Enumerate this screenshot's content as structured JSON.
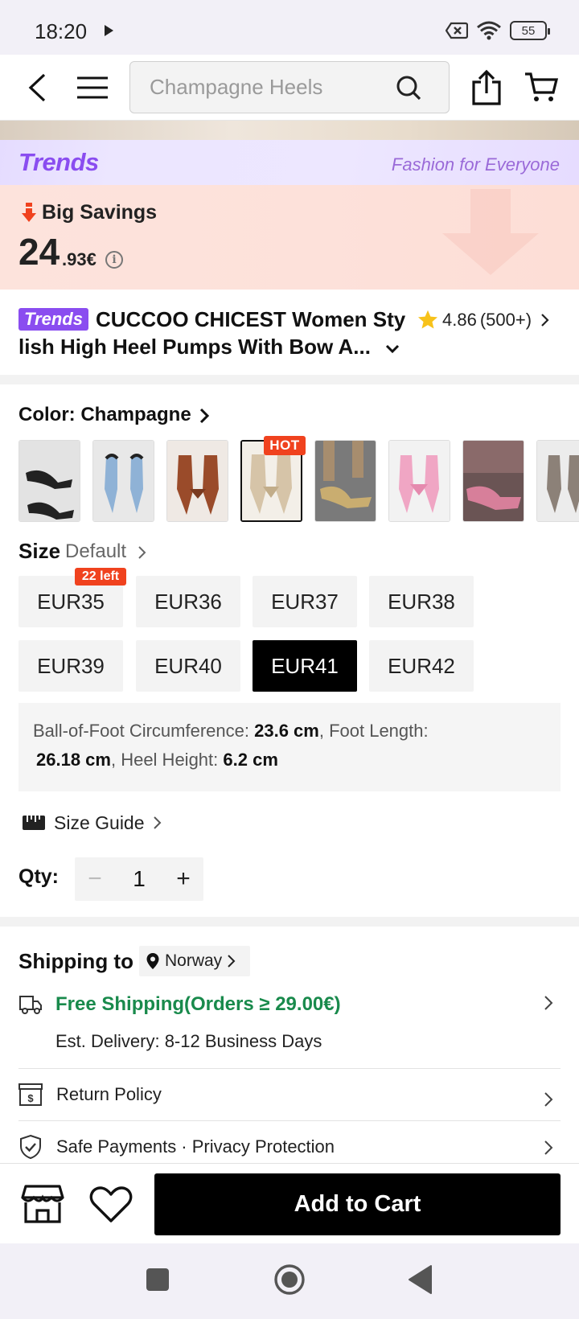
{
  "status_bar": {
    "time": "18:20",
    "battery": "55"
  },
  "header": {
    "search_placeholder": "Champagne Heels"
  },
  "promo": {
    "brand_logo": "Trends",
    "tagline": "Fashion for Everyone",
    "savings_title": "Big Savings",
    "price_whole": "24",
    "price_decimal": ".93€"
  },
  "product": {
    "badge": "Trends",
    "title_line1": "CUCCOO CHICEST Women Sty",
    "title_line2": "lish High Heel Pumps With Bow A...",
    "rating": "4.86",
    "rating_count": "(500+)"
  },
  "color": {
    "label": "Color: Champagne",
    "hot_badge": "HOT",
    "swatches": [
      {
        "name": "Black",
        "colors": [
          "#e3e3e3",
          "#222222"
        ]
      },
      {
        "name": "Blue",
        "colors": [
          "#e8e8e8",
          "#8fb2d6"
        ]
      },
      {
        "name": "Brown",
        "colors": [
          "#efe9e4",
          "#9a4b2a"
        ]
      },
      {
        "name": "Champagne",
        "colors": [
          "#f3efe8",
          "#d6c4a8"
        ]
      },
      {
        "name": "Gold",
        "colors": [
          "#7a7a7a",
          "#c9ad70"
        ]
      },
      {
        "name": "Pink",
        "colors": [
          "#f2f2f2",
          "#f0a6c4"
        ]
      },
      {
        "name": "Rose",
        "colors": [
          "#6a5454",
          "#d77f9a"
        ]
      },
      {
        "name": "Silver",
        "colors": [
          "#ececec",
          "#8c8178"
        ]
      }
    ]
  },
  "size": {
    "label": "Size",
    "default_label": "Default",
    "stock_badge": "22 left",
    "options": [
      "EUR35",
      "EUR36",
      "EUR37",
      "EUR38",
      "EUR39",
      "EUR40",
      "EUR41",
      "EUR42"
    ],
    "selected": "EUR41",
    "measure": {
      "ball_label": "Ball-of-Foot Circumference:",
      "ball_value": "23.6 cm",
      "foot_label": ", Foot Length:",
      "foot_value": "26.18 cm",
      "heel_label": ", Heel Height:",
      "heel_value": "6.2 cm"
    },
    "guide_label": "Size Guide"
  },
  "qty": {
    "label": "Qty:",
    "minus": "−",
    "value": "1",
    "plus": "+"
  },
  "shipping": {
    "label": "Shipping to",
    "country": "Norway",
    "free_shipping": "Free Shipping(Orders ≥ 29.00€)",
    "est_delivery": "Est. Delivery: 8-12 Business Days",
    "return_policy": "Return Policy",
    "safe_payments": "Safe Payments · Privacy Protection"
  },
  "actions": {
    "add_to_cart": "Add to Cart"
  },
  "colors": {
    "accent_red": "#f0421e",
    "trends_purple": "#8a4df0",
    "ship_green": "#198a4c"
  }
}
